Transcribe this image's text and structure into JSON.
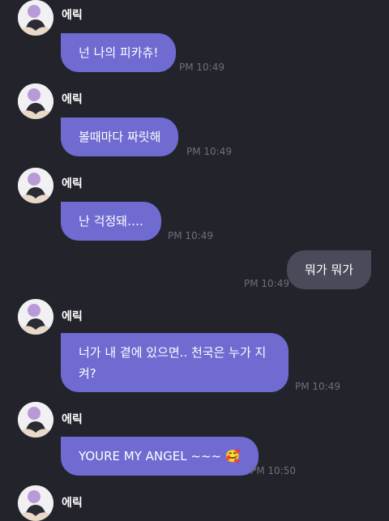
{
  "messages": [
    {
      "sender": "에릭",
      "text": "넌 나의 피카츄!",
      "time": "PM 10:49"
    },
    {
      "sender": "에릭",
      "text": "볼때마다 짜릿해",
      "time": "PM 10:49"
    },
    {
      "sender": "에릭",
      "text": "난 걱정돼….",
      "time": "PM 10:49"
    },
    {
      "text": "뭐가 뭐가",
      "time": "PM 10:49"
    },
    {
      "sender": "에릭",
      "text": "너가 내 곁에 있으면.. 천국은 누가 지켜?",
      "time": "PM 10:49"
    },
    {
      "sender": "에릭",
      "text": "YOURE MY ANGEL ~~~ 🥰",
      "time": "PM 10:50"
    },
    {
      "sender": "에릭"
    }
  ],
  "icons": {
    "avatar": "profile-avatar-icon"
  },
  "colors": {
    "background": "#23232c",
    "incoming_bubble": "#6f6bd1",
    "outgoing_bubble": "#4a4a5b",
    "timestamp": "#6f6f7d"
  }
}
